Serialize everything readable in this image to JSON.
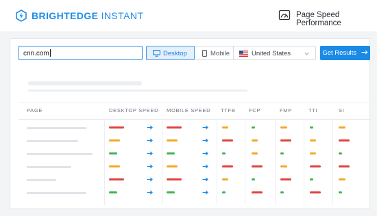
{
  "header": {
    "brand_bold": "BRIGHTEDGE",
    "brand_light": " INSTANT",
    "section_label": "Page Speed Performance"
  },
  "search": {
    "url_value": "cnn.com",
    "device_options": [
      "Desktop",
      "Mobile"
    ],
    "selected_device": "Desktop",
    "country": "United States",
    "submit_label": "Get Results",
    "submit_icon": "arrow-right-icon"
  },
  "table": {
    "columns": [
      "PAGE",
      "DESKTOP SPEED",
      "MOBILE SPEED",
      "TTFB",
      "FCP",
      "FMP",
      "TTI",
      "SI"
    ],
    "rows": [
      {
        "desktop": "red",
        "mobile": "red",
        "ttfb": "orange",
        "fcp": "green",
        "fmp": "orange",
        "tti": "green",
        "si": "orange"
      },
      {
        "desktop": "orange",
        "mobile": "orange",
        "ttfb": "red",
        "fcp": "orange",
        "fmp": "red",
        "tti": "orange",
        "si": "red"
      },
      {
        "desktop": "green",
        "mobile": "green",
        "ttfb": "green",
        "fcp": "orange",
        "fmp": "green",
        "tti": "orange",
        "si": "green"
      },
      {
        "desktop": "orange",
        "mobile": "orange",
        "ttfb": "red",
        "fcp": "red",
        "fmp": "orange",
        "tti": "red",
        "si": "red"
      },
      {
        "desktop": "red",
        "mobile": "red",
        "ttfb": "orange",
        "fcp": "green",
        "fmp": "red",
        "tti": "green",
        "si": "orange"
      },
      {
        "desktop": "green",
        "mobile": "green",
        "ttfb": "green",
        "fcp": "red",
        "fmp": "green",
        "tti": "red",
        "si": "green"
      }
    ]
  },
  "colors": {
    "accent": "#1a8ae5",
    "red": "#e0413a",
    "orange": "#f5a623",
    "green": "#3fb34f",
    "arrow": "#1a8ae5"
  }
}
